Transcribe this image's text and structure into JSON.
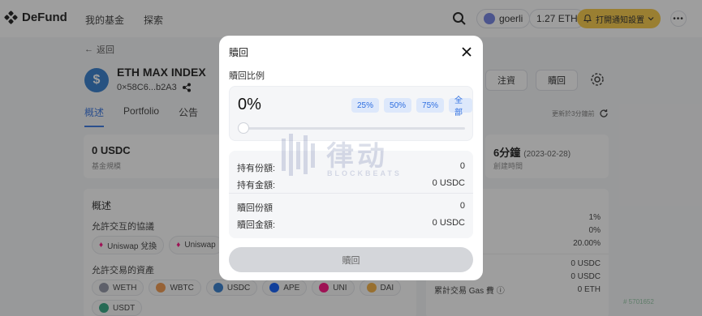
{
  "header": {
    "brand": "DeFund",
    "nav": [
      "我的基金",
      "探索"
    ],
    "network": "goerli",
    "balance": "1.27 ETH",
    "notify_label": "打開通知設置"
  },
  "fund": {
    "back_label": "返回",
    "name": "ETH MAX INDEX",
    "address": "0×58C6...b2A3",
    "tabs": [
      "概述",
      "Portfolio",
      "公告"
    ],
    "follow_label": "注資",
    "redeem_label": "贖回",
    "updated_text": "更新於3分鐘前"
  },
  "stats": [
    {
      "value": "0 USDC",
      "label": "基金規模"
    },
    {
      "value": "6分鐘",
      "sub": "(2023-02-28)",
      "label": "創建時間"
    }
  ],
  "overview": {
    "title": "概述",
    "protocols_title": "允許交互的協議",
    "protocols": [
      "Uniswap 兌換",
      "Uniswap"
    ],
    "assets_title": "允許交易的資產",
    "assets": [
      {
        "name": "WETH",
        "color": "#8a8fa0"
      },
      {
        "name": "WBTC",
        "color": "#f09242"
      },
      {
        "name": "USDC",
        "color": "#2775ca"
      },
      {
        "name": "APE",
        "color": "#0054f9"
      },
      {
        "name": "UNI",
        "color": "#ff007a"
      },
      {
        "name": "DAI",
        "color": "#f5ac37"
      },
      {
        "name": "USDT",
        "color": "#26a17b"
      }
    ]
  },
  "right_panel": {
    "values": [
      "1%",
      "0%",
      "20.00%"
    ],
    "amounts": [
      "0 USDC",
      "0 USDC"
    ],
    "gas_label": "累計交易 Gas 費",
    "gas_value": "0 ETH"
  },
  "modal": {
    "title": "贖回",
    "ratio_label": "贖回比例",
    "ratio_value": "0%",
    "presets": [
      "25%",
      "50%",
      "75%",
      "全部"
    ],
    "slider_value": 0,
    "rows": [
      {
        "label": "持有份額:",
        "value": "0"
      },
      {
        "label": "持有金額:",
        "value": "0 USDC"
      },
      {
        "label": "贖回份額",
        "value": "0"
      },
      {
        "label": "贖回金額:",
        "value": "0 USDC"
      }
    ],
    "submit_label": "贖回"
  },
  "watermark": {
    "text": "律动",
    "sub": "BLOCKBEATS"
  },
  "corner_mark": "# 5701652",
  "colors": {
    "accent": "#2f6fe0",
    "notify": "#f7c63b",
    "usdc": "#2775ca"
  }
}
